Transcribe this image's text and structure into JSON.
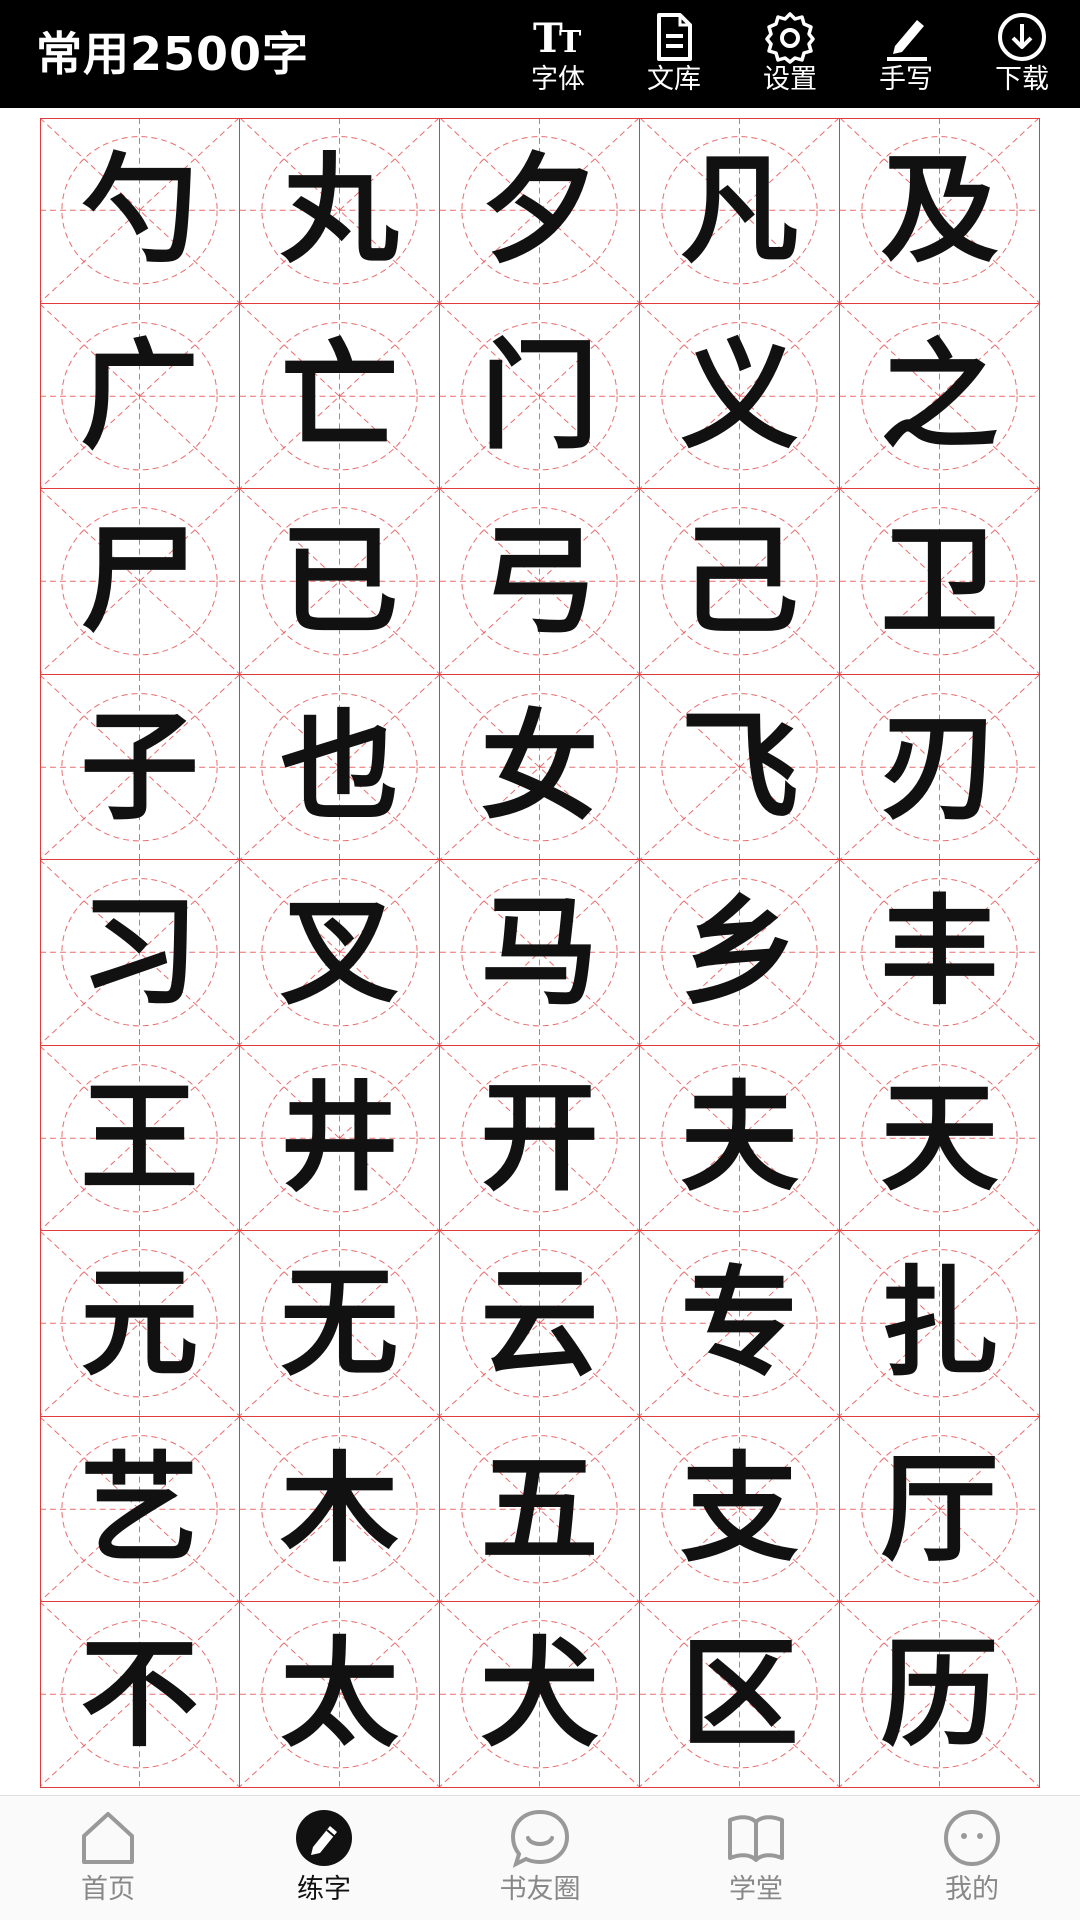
{
  "header": {
    "title": "常用2500字",
    "tools": [
      {
        "label": "字体",
        "icon": "font-size-icon"
      },
      {
        "label": "文库",
        "icon": "document-icon"
      },
      {
        "label": "设置",
        "icon": "gear-icon"
      },
      {
        "label": "手写",
        "icon": "pen-icon"
      },
      {
        "label": "下载",
        "icon": "download-icon"
      }
    ]
  },
  "grid": {
    "guide_color": "#e23b3b",
    "characters": [
      "勺",
      "丸",
      "夕",
      "凡",
      "及",
      "广",
      "亡",
      "门",
      "义",
      "之",
      "尸",
      "已",
      "弓",
      "己",
      "卫",
      "子",
      "也",
      "女",
      "飞",
      "刃",
      "习",
      "叉",
      "马",
      "乡",
      "丰",
      "王",
      "井",
      "开",
      "夫",
      "天",
      "元",
      "无",
      "云",
      "专",
      "扎",
      "艺",
      "木",
      "五",
      "支",
      "厅",
      "不",
      "太",
      "犬",
      "区",
      "历"
    ]
  },
  "nav": {
    "items": [
      {
        "label": "首页",
        "icon": "home-icon",
        "active": false
      },
      {
        "label": "练字",
        "icon": "pencil-circle-icon",
        "active": true
      },
      {
        "label": "书友圈",
        "icon": "chat-bubble-icon",
        "active": false
      },
      {
        "label": "学堂",
        "icon": "book-icon",
        "active": false
      },
      {
        "label": "我的",
        "icon": "profile-face-icon",
        "active": false
      }
    ]
  }
}
